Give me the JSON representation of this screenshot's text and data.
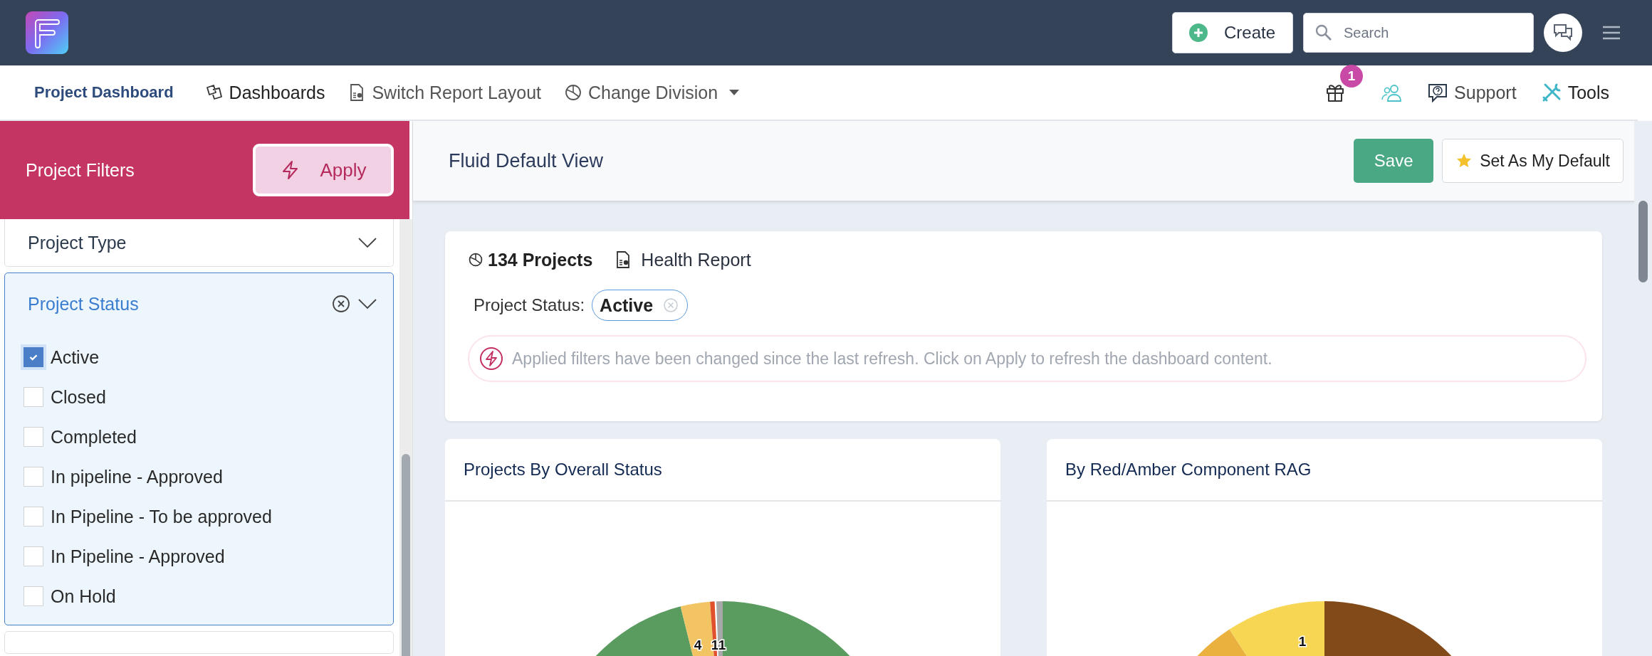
{
  "top_bar": {
    "create_button": "Create",
    "search": {
      "placeholder": "Search"
    }
  },
  "nav": {
    "title": "Project Dashboard",
    "items": [
      {
        "label": "Dashboards",
        "kind": "dashboards",
        "dropdown": false
      },
      {
        "label": "Switch Report Layout",
        "kind": "layout",
        "dropdown": false
      },
      {
        "label": "Change Division",
        "kind": "division",
        "dropdown": true
      }
    ],
    "notification_count": "1",
    "right_items": [
      {
        "label": "Support",
        "kind": "support"
      },
      {
        "label": "Tools",
        "kind": "tools"
      }
    ]
  },
  "sidebar": {
    "title": "Project Filters",
    "apply_button": "Apply",
    "filters": [
      {
        "label": "Project Type",
        "expanded": false
      },
      {
        "label": "Project Status",
        "expanded": true,
        "options": [
          {
            "label": "Active",
            "checked": true
          },
          {
            "label": "Closed",
            "checked": false
          },
          {
            "label": "Completed",
            "checked": false
          },
          {
            "label": "In pipeline - Approved",
            "checked": false
          },
          {
            "label": "In Pipeline - To be approved",
            "checked": false
          },
          {
            "label": "In Pipeline - Approved",
            "checked": false
          },
          {
            "label": "On Hold",
            "checked": false
          }
        ]
      }
    ]
  },
  "view": {
    "title": "Fluid Default View",
    "save_button": "Save",
    "default_button": "Set As My Default"
  },
  "summary": {
    "count": "134 Projects",
    "report": "Health Report",
    "filter_label": "Project Status:",
    "filter_chips": [
      "Active"
    ],
    "notice": "Applied filters have been changed since the last refresh. Click on Apply to refresh the dashboard content."
  },
  "charts": [
    {
      "title": "Projects By Overall Status",
      "kind": "overall",
      "slice_labels": [
        "4",
        "1",
        "1"
      ]
    },
    {
      "title": "By Red/Amber Component RAG",
      "kind": "rag",
      "slice_labels": [
        "1"
      ]
    }
  ]
}
